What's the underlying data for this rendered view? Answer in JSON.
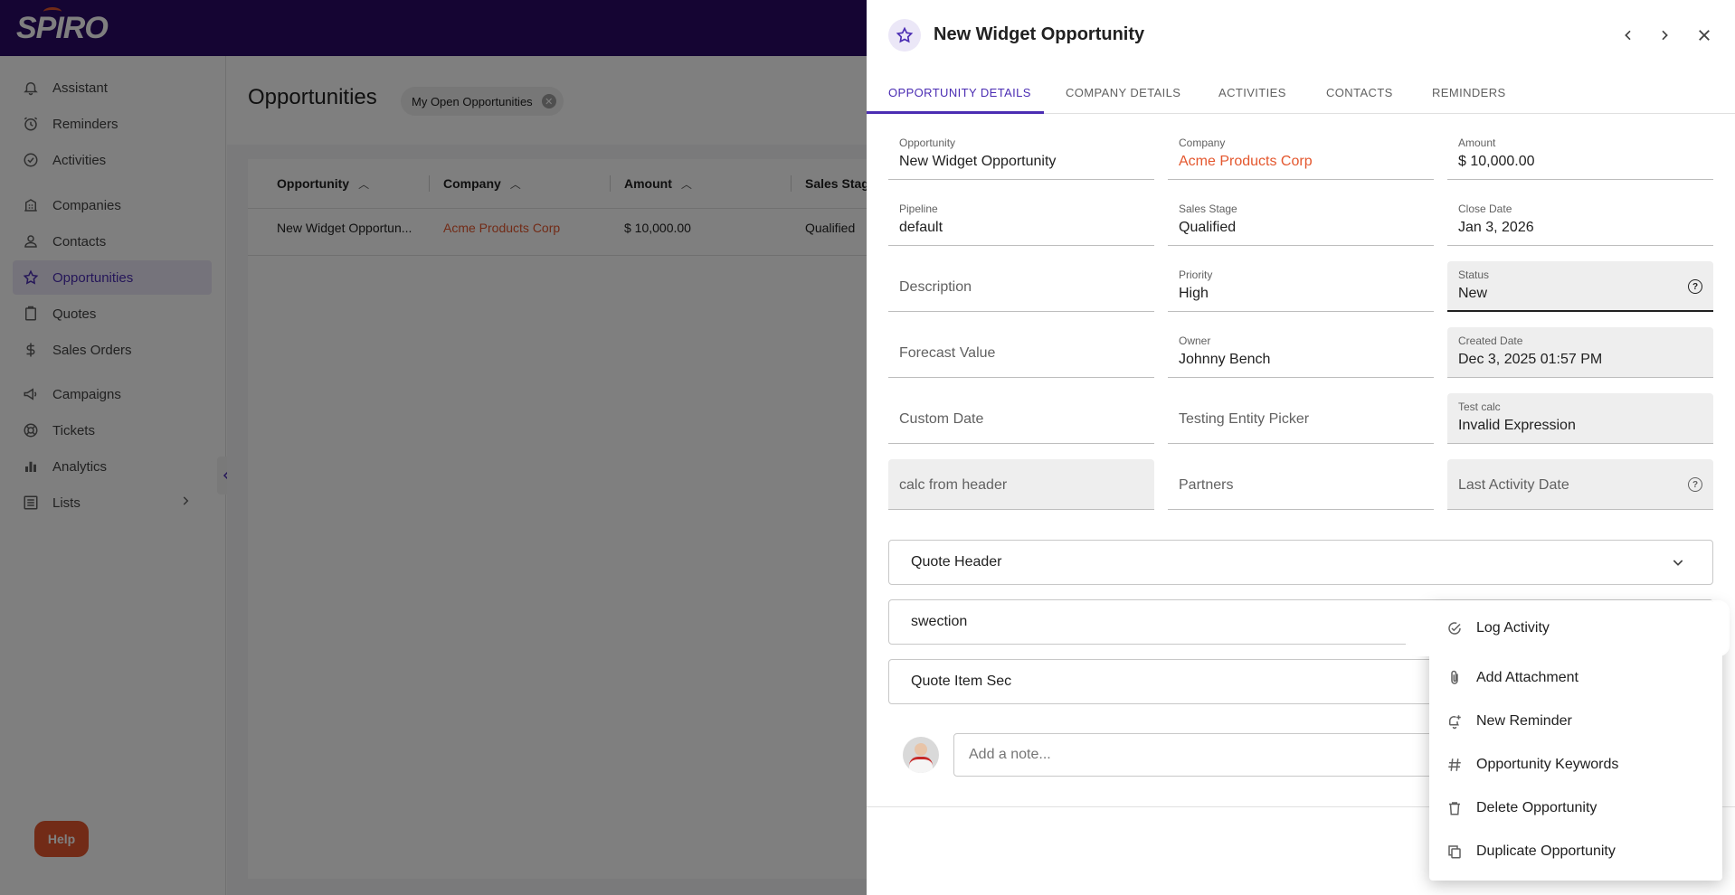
{
  "app": {
    "logo": "SPIRO"
  },
  "sidebar": {
    "items": [
      {
        "label": "Assistant",
        "icon": "bell-ring-icon"
      },
      {
        "label": "Reminders",
        "icon": "alarm-clock-icon"
      },
      {
        "label": "Activities",
        "icon": "check-circle-icon"
      },
      {
        "label": "Companies",
        "icon": "building-icon"
      },
      {
        "label": "Contacts",
        "icon": "person-icon"
      },
      {
        "label": "Opportunities",
        "icon": "star-icon",
        "active": true
      },
      {
        "label": "Quotes",
        "icon": "clipboard-icon"
      },
      {
        "label": "Sales Orders",
        "icon": "dollar-icon"
      },
      {
        "label": "Campaigns",
        "icon": "megaphone-icon"
      },
      {
        "label": "Tickets",
        "icon": "lifebuoy-icon"
      },
      {
        "label": "Analytics",
        "icon": "bar-chart-icon"
      },
      {
        "label": "Lists",
        "icon": "list-icon"
      }
    ],
    "help_label": "Help"
  },
  "main": {
    "title": "Opportunities",
    "filter_chip": "My Open Opportunities",
    "table": {
      "headers": [
        "Opportunity",
        "Company",
        "Amount",
        "Sales Stag"
      ],
      "rows": [
        {
          "opportunity": "New Widget Opportun...",
          "company": "Acme Products Corp",
          "amount": "$ 10,000.00",
          "stage": "Qualified"
        }
      ]
    }
  },
  "drawer": {
    "title": "New Widget Opportunity",
    "tabs": [
      "OPPORTUNITY DETAILS",
      "COMPANY DETAILS",
      "ACTIVITIES",
      "CONTACTS",
      "REMINDERS"
    ],
    "fields": {
      "opportunity": {
        "label": "Opportunity",
        "value": "New Widget Opportunity"
      },
      "company": {
        "label": "Company",
        "value": "Acme Products Corp"
      },
      "amount": {
        "label": "Amount",
        "value": "$ 10,000.00"
      },
      "pipeline": {
        "label": "Pipeline",
        "value": "default"
      },
      "sales_stage": {
        "label": "Sales Stage",
        "value": "Qualified"
      },
      "close_date": {
        "label": "Close Date",
        "value": "Jan 3, 2026"
      },
      "description": {
        "placeholder": "Description"
      },
      "priority": {
        "label": "Priority",
        "value": "High"
      },
      "status": {
        "label": "Status",
        "value": "New"
      },
      "forecast_value": {
        "placeholder": "Forecast Value"
      },
      "owner": {
        "label": "Owner",
        "value": "Johnny Bench"
      },
      "created_date": {
        "label": "Created Date",
        "value": "Dec 3, 2025 01:57 PM"
      },
      "custom_date": {
        "placeholder": "Custom Date"
      },
      "testing_entity_picker": {
        "placeholder": "Testing Entity Picker"
      },
      "test_calc": {
        "label": "Test calc",
        "value": "Invalid Expression"
      },
      "calc_from_header": {
        "placeholder": "calc from header"
      },
      "partners": {
        "placeholder": "Partners"
      },
      "last_activity_date": {
        "placeholder": "Last Activity Date"
      }
    },
    "sections": [
      "Quote Header",
      "swection",
      "Quote Item Sec"
    ],
    "note_placeholder": "Add a note..."
  },
  "menu": {
    "items": [
      {
        "label": "Log Activity",
        "icon": "log-activity-icon"
      },
      {
        "label": "Add Attachment",
        "icon": "paperclip-icon"
      },
      {
        "label": "New Reminder",
        "icon": "bell-plus-icon"
      },
      {
        "label": "Opportunity Keywords",
        "icon": "hash-icon"
      },
      {
        "label": "Delete Opportunity",
        "icon": "trash-icon"
      },
      {
        "label": "Duplicate Opportunity",
        "icon": "copy-icon"
      }
    ]
  },
  "colors": {
    "brand": "#2a0a66",
    "accent": "#4b2db3",
    "link": "#e4572e"
  }
}
